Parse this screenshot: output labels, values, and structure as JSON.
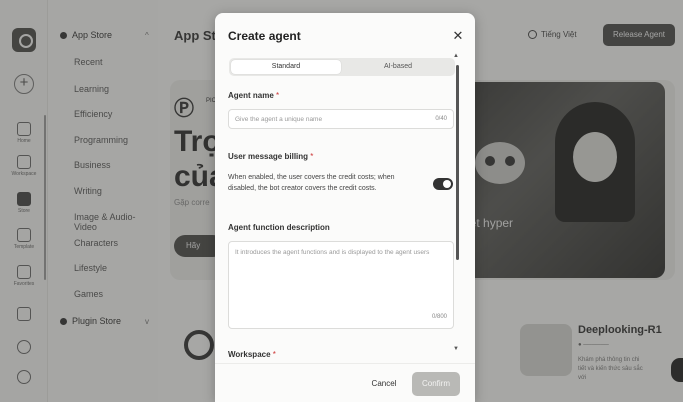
{
  "rail": {
    "items": [
      {
        "label": "Home",
        "icon": "home-icon"
      },
      {
        "label": "Workspace",
        "icon": "workspace-icon"
      },
      {
        "label": "Store",
        "icon": "store-icon"
      },
      {
        "label": "Template",
        "icon": "template-icon"
      },
      {
        "label": "Favorites",
        "icon": "favorites-icon"
      }
    ]
  },
  "sidebar": {
    "app_store": "App Store",
    "items": [
      "Recent",
      "Learning",
      "Efficiency",
      "Programming",
      "Business",
      "Writing",
      "Image & Audio-Video",
      "Characters",
      "Lifestyle",
      "Games"
    ],
    "plugin_store": "Plugin Store"
  },
  "header": {
    "title": "App Sto",
    "language": "Tiếng Việt",
    "release_button": "Release Agent"
  },
  "hero": {
    "brand": "PIC",
    "headline_1": "Trợ",
    "headline_2": "của",
    "description": "Gặp corre",
    "cta": "Hãy",
    "image_caption": "net hyper"
  },
  "card": {
    "title": "Deeplooking-R1",
    "desc": "Khám phá thông tin chi tiết và kiến thức sâu sắc với"
  },
  "modal": {
    "title": "Create agent",
    "tabs": {
      "standard": "Standard",
      "ai_based": "AI-based"
    },
    "agent_name": {
      "label": "Agent name",
      "placeholder": "Give the agent a unique name",
      "count": "0/40"
    },
    "billing": {
      "label": "User message billing",
      "description": "When enabled, the user covers the credit costs; when disabled, the bot creator covers the credit costs.",
      "enabled": true
    },
    "description": {
      "label": "Agent function description",
      "placeholder": "It introduces the agent functions and is displayed to the agent users",
      "count": "0/800"
    },
    "workspace_label": "Workspace",
    "cancel": "Cancel",
    "confirm": "Confirm"
  }
}
